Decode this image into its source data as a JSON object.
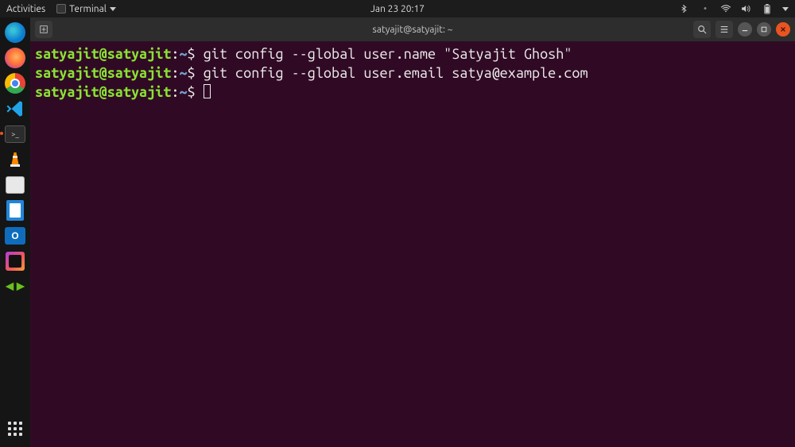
{
  "topbar": {
    "activities": "Activities",
    "app_menu": "Terminal",
    "datetime": "Jan 23  20:17"
  },
  "dock": {
    "items": [
      {
        "name": "edge",
        "color": "#0b7ccf",
        "glyph": "e"
      },
      {
        "name": "firefox",
        "color": "#ff7139",
        "glyph": ""
      },
      {
        "name": "chrome",
        "color": "#f1f1f1",
        "glyph": ""
      },
      {
        "name": "vscode",
        "color": "#007acc",
        "glyph": ""
      },
      {
        "name": "terminal",
        "color": "#333",
        "glyph": ">_"
      },
      {
        "name": "vlc",
        "color": "#ff8800",
        "glyph": ""
      },
      {
        "name": "files",
        "color": "#d6d6d6",
        "glyph": ""
      },
      {
        "name": "writer",
        "color": "#1876d2",
        "glyph": ""
      },
      {
        "name": "outlook",
        "color": "#0f6cbd",
        "glyph": ""
      },
      {
        "name": "intellij",
        "color": "#6a2b86",
        "glyph": ""
      },
      {
        "name": "other",
        "color": "#5bbb15",
        "glyph": ""
      }
    ]
  },
  "window": {
    "title": "satyajit@satyajit: ~"
  },
  "terminal": {
    "lines": [
      {
        "user": "satyajit@satyajit",
        "path": "~",
        "cmd": "git config --global user.name \"Satyajit Ghosh\""
      },
      {
        "user": "satyajit@satyajit",
        "path": "~",
        "cmd": "git config --global user.email satya@example.com"
      },
      {
        "user": "satyajit@satyajit",
        "path": "~",
        "cmd": ""
      }
    ]
  }
}
